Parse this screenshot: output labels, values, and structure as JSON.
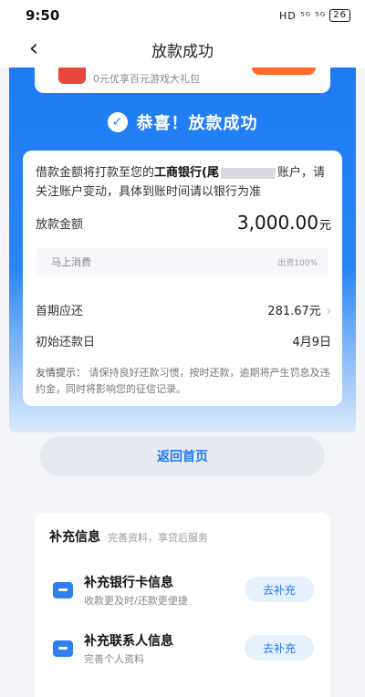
{
  "status_bar": {
    "time": "9:50",
    "icons_text": "HD ⁵ᴳ ⁵ᴳ",
    "battery": "26"
  },
  "nav": {
    "back_icon": "chevron-left-icon",
    "title": "放款成功"
  },
  "promo": {
    "text": "0元优享百元游戏大礼包"
  },
  "success": {
    "text": "恭喜！放款成功"
  },
  "notice": {
    "prefix": "借款金额将打款至您的",
    "bank": "工商银行(尾",
    "suffix": "账户，请关注账户变动，具体到账时间请以银行为准"
  },
  "loan": {
    "amount_label": "放款金额",
    "amount_value": "3,000.00",
    "amount_unit": "元",
    "provider": "马上消费",
    "provider_share": "出资100%",
    "first_label": "首期应还",
    "first_value": "281.67元",
    "start_label": "初始还款日",
    "start_value": "4月9日"
  },
  "tip": {
    "label": "友情提示：",
    "text": "请保持良好还款习惯，按时还款，逾期将产生罚息及违约金，同时将影响您的征信记录。"
  },
  "home_button": "返回首页",
  "supplement": {
    "title": "补充信息",
    "subtitle": "完善资料，享贷后服务",
    "items": [
      {
        "title": "补充银行卡信息",
        "desc": "收款更及时/还款更便捷",
        "button": "去补充"
      },
      {
        "title": "补充联系人信息",
        "desc": "完善个人资料",
        "button": "去补充"
      }
    ]
  },
  "colors": {
    "accent": "#1e7bf3",
    "background": "#f3f5f9"
  }
}
